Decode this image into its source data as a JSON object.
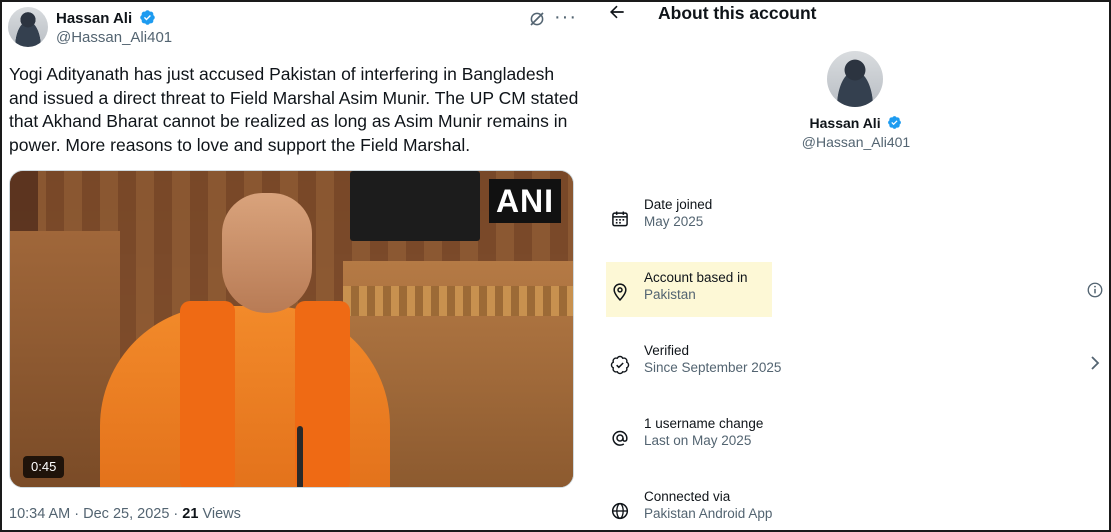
{
  "tweet": {
    "author_name": "Hassan Ali",
    "author_handle": "@Hassan_Ali401",
    "text": "Yogi Adityanath has just accused Pakistan of interfering in Bangladesh and issued a direct threat to Field Marshal Asim Munir. The UP CM stated that Akhand Bharat cannot be realized as long as Asim Munir remains in power. More reasons to love and support the Field Marshal.",
    "media": {
      "watermark": "ANI",
      "duration": "0:45"
    },
    "timestamp": "10:34 AM · Dec 25, 2025 · ",
    "views_count": "21",
    "views_label": " Views"
  },
  "about": {
    "title": "About this account",
    "name": "Hassan Ali",
    "handle": "@Hassan_Ali401",
    "rows": [
      {
        "label": "Date joined",
        "value": "May 2025",
        "icon": "calendar-icon"
      },
      {
        "label": "Account based in",
        "value": "Pakistan",
        "icon": "location-pin-icon"
      },
      {
        "label": "Verified",
        "value": "Since September 2025",
        "icon": "verified-badge-icon"
      },
      {
        "label": "1 username change",
        "value": "Last on May 2025",
        "icon": "at-sign-icon"
      },
      {
        "label": "Connected via",
        "value": "Pakistan Android App",
        "icon": "globe-icon"
      }
    ]
  },
  "colors": {
    "verified_blue": "#1d9bf0",
    "text_primary": "#0f1419",
    "text_secondary": "#536471",
    "highlight": "#fdf8d6"
  }
}
